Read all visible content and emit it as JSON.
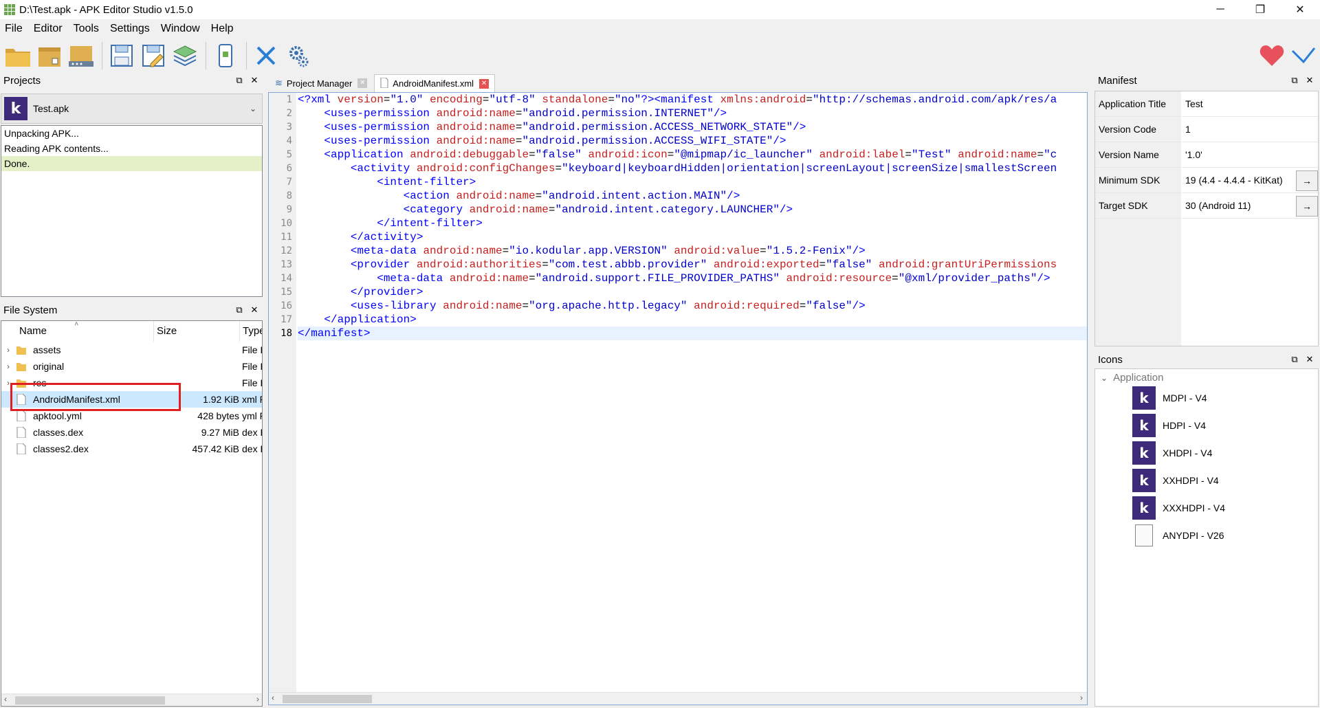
{
  "window": {
    "title": "D:\\Test.apk - APK Editor Studio v1.5.0",
    "controls": {
      "minimize": "─",
      "restore": "❐",
      "close": "✕"
    }
  },
  "menu": [
    "File",
    "Editor",
    "Tools",
    "Settings",
    "Window",
    "Help"
  ],
  "toolbar": {
    "icons": [
      "open-folder-icon",
      "open-apk-icon",
      "open-project-icon",
      "save-icon",
      "save-as-icon",
      "layers-icon",
      "install-icon",
      "close-icon",
      "settings-icon"
    ],
    "right_icons": [
      "heart-icon",
      "check-icon"
    ],
    "colors": {
      "folder": "#e8b84a",
      "save": "#3a6fb0",
      "close_x": "#2a7fd4",
      "heart": "#e8505b"
    }
  },
  "projects": {
    "title": "Projects",
    "selected_project": "Test.apk",
    "project_badge": "k",
    "log": [
      "Unpacking APK...",
      "Reading APK contents...",
      "Done."
    ]
  },
  "file_system": {
    "title": "File System",
    "columns": [
      "Name",
      "Size",
      "Type"
    ],
    "rows": [
      {
        "name": "assets",
        "size": "",
        "type": "File F",
        "kind": "folder"
      },
      {
        "name": "original",
        "size": "",
        "type": "File F",
        "kind": "folder"
      },
      {
        "name": "res",
        "size": "",
        "type": "File F",
        "kind": "folder"
      },
      {
        "name": "AndroidManifest.xml",
        "size": "1.92 KiB",
        "type": "xml F",
        "kind": "file"
      },
      {
        "name": "apktool.yml",
        "size": "428 bytes",
        "type": "yml F",
        "kind": "file"
      },
      {
        "name": "classes.dex",
        "size": "9.27 MiB",
        "type": "dex F",
        "kind": "file"
      },
      {
        "name": "classes2.dex",
        "size": "457.42 KiB",
        "type": "dex F",
        "kind": "file"
      }
    ]
  },
  "editor": {
    "tabs": [
      {
        "label": "Project Manager",
        "active": false
      },
      {
        "label": "AndroidManifest.xml",
        "active": true
      }
    ],
    "current_line": 18,
    "lines": [
      [
        [
          "t",
          "<?xml "
        ],
        [
          "a",
          "version"
        ],
        [
          "p",
          "="
        ],
        [
          "v",
          "\"1.0\""
        ],
        [
          "p",
          " "
        ],
        [
          "a",
          "encoding"
        ],
        [
          "p",
          "="
        ],
        [
          "v",
          "\"utf-8\""
        ],
        [
          "p",
          " "
        ],
        [
          "a",
          "standalone"
        ],
        [
          "p",
          "="
        ],
        [
          "v",
          "\"no\""
        ],
        [
          "t",
          "?><manifest "
        ],
        [
          "a",
          "xmlns:android"
        ],
        [
          "p",
          "="
        ],
        [
          "v",
          "\"http://schemas.android.com/apk/res/a"
        ]
      ],
      [
        [
          "p",
          "    "
        ],
        [
          "t",
          "<uses-permission "
        ],
        [
          "a",
          "android:name"
        ],
        [
          "p",
          "="
        ],
        [
          "v",
          "\"android.permission.INTERNET\""
        ],
        [
          "t",
          "/>"
        ]
      ],
      [
        [
          "p",
          "    "
        ],
        [
          "t",
          "<uses-permission "
        ],
        [
          "a",
          "android:name"
        ],
        [
          "p",
          "="
        ],
        [
          "v",
          "\"android.permission.ACCESS_NETWORK_STATE\""
        ],
        [
          "t",
          "/>"
        ]
      ],
      [
        [
          "p",
          "    "
        ],
        [
          "t",
          "<uses-permission "
        ],
        [
          "a",
          "android:name"
        ],
        [
          "p",
          "="
        ],
        [
          "v",
          "\"android.permission.ACCESS_WIFI_STATE\""
        ],
        [
          "t",
          "/>"
        ]
      ],
      [
        [
          "p",
          "    "
        ],
        [
          "t",
          "<application "
        ],
        [
          "a",
          "android:debuggable"
        ],
        [
          "p",
          "="
        ],
        [
          "v",
          "\"false\""
        ],
        [
          "p",
          " "
        ],
        [
          "a",
          "android:icon"
        ],
        [
          "p",
          "="
        ],
        [
          "v",
          "\"@mipmap/ic_launcher\""
        ],
        [
          "p",
          " "
        ],
        [
          "a",
          "android:label"
        ],
        [
          "p",
          "="
        ],
        [
          "v",
          "\"Test\""
        ],
        [
          "p",
          " "
        ],
        [
          "a",
          "android:name"
        ],
        [
          "p",
          "="
        ],
        [
          "v",
          "\"c"
        ]
      ],
      [
        [
          "p",
          "        "
        ],
        [
          "t",
          "<activity "
        ],
        [
          "a",
          "android:configChanges"
        ],
        [
          "p",
          "="
        ],
        [
          "v",
          "\"keyboard|keyboardHidden|orientation|screenLayout|screenSize|smallestScreen"
        ]
      ],
      [
        [
          "p",
          "            "
        ],
        [
          "t",
          "<intent-filter>"
        ]
      ],
      [
        [
          "p",
          "                "
        ],
        [
          "t",
          "<action "
        ],
        [
          "a",
          "android:name"
        ],
        [
          "p",
          "="
        ],
        [
          "v",
          "\"android.intent.action.MAIN\""
        ],
        [
          "t",
          "/>"
        ]
      ],
      [
        [
          "p",
          "                "
        ],
        [
          "t",
          "<category "
        ],
        [
          "a",
          "android:name"
        ],
        [
          "p",
          "="
        ],
        [
          "v",
          "\"android.intent.category.LAUNCHER\""
        ],
        [
          "t",
          "/>"
        ]
      ],
      [
        [
          "p",
          "            "
        ],
        [
          "t",
          "</intent-filter>"
        ]
      ],
      [
        [
          "p",
          "        "
        ],
        [
          "t",
          "</activity>"
        ]
      ],
      [
        [
          "p",
          "        "
        ],
        [
          "t",
          "<meta-data "
        ],
        [
          "a",
          "android:name"
        ],
        [
          "p",
          "="
        ],
        [
          "v",
          "\"io.kodular.app.VERSION\""
        ],
        [
          "p",
          " "
        ],
        [
          "a",
          "android:value"
        ],
        [
          "p",
          "="
        ],
        [
          "v",
          "\"1.5.2-Fenix\""
        ],
        [
          "t",
          "/>"
        ]
      ],
      [
        [
          "p",
          "        "
        ],
        [
          "t",
          "<provider "
        ],
        [
          "a",
          "android:authorities"
        ],
        [
          "p",
          "="
        ],
        [
          "v",
          "\"com.test.abbb.provider\""
        ],
        [
          "p",
          " "
        ],
        [
          "a",
          "android:exported"
        ],
        [
          "p",
          "="
        ],
        [
          "v",
          "\"false\""
        ],
        [
          "p",
          " "
        ],
        [
          "a",
          "android:grantUriPermissions"
        ]
      ],
      [
        [
          "p",
          "            "
        ],
        [
          "t",
          "<meta-data "
        ],
        [
          "a",
          "android:name"
        ],
        [
          "p",
          "="
        ],
        [
          "v",
          "\"android.support.FILE_PROVIDER_PATHS\""
        ],
        [
          "p",
          " "
        ],
        [
          "a",
          "android:resource"
        ],
        [
          "p",
          "="
        ],
        [
          "v",
          "\"@xml/provider_paths\""
        ],
        [
          "t",
          "/>"
        ]
      ],
      [
        [
          "p",
          "        "
        ],
        [
          "t",
          "</provider>"
        ]
      ],
      [
        [
          "p",
          "        "
        ],
        [
          "t",
          "<uses-library "
        ],
        [
          "a",
          "android:name"
        ],
        [
          "p",
          "="
        ],
        [
          "v",
          "\"org.apache.http.legacy\""
        ],
        [
          "p",
          " "
        ],
        [
          "a",
          "android:required"
        ],
        [
          "p",
          "="
        ],
        [
          "v",
          "\"false\""
        ],
        [
          "t",
          "/>"
        ]
      ],
      [
        [
          "p",
          "    "
        ],
        [
          "t",
          "</application>"
        ]
      ],
      [
        [
          "t",
          "</manifest>"
        ]
      ]
    ]
  },
  "manifest": {
    "title": "Manifest",
    "properties": [
      {
        "key": "Application Title",
        "value": "Test",
        "has_button": false
      },
      {
        "key": "Version Code",
        "value": "1",
        "has_button": false
      },
      {
        "key": "Version Name",
        "value": "'1.0'",
        "has_button": false
      },
      {
        "key": "Minimum SDK",
        "value": "19 (4.4 - 4.4.4 - KitKat)",
        "has_button": true
      },
      {
        "key": "Target SDK",
        "value": "30 (Android 11)",
        "has_button": true
      }
    ],
    "button_label": "→"
  },
  "icons": {
    "title": "Icons",
    "group": "Application",
    "items": [
      {
        "label": "MDPI - V4",
        "kind": "kodular"
      },
      {
        "label": "HDPI - V4",
        "kind": "kodular"
      },
      {
        "label": "XHDPI - V4",
        "kind": "kodular"
      },
      {
        "label": "XXHDPI - V4",
        "kind": "kodular"
      },
      {
        "label": "XXXHDPI - V4",
        "kind": "kodular"
      },
      {
        "label": "ANYDPI - V26",
        "kind": "file"
      }
    ]
  },
  "dock_buttons": {
    "float": "⧉",
    "close": "✕"
  }
}
